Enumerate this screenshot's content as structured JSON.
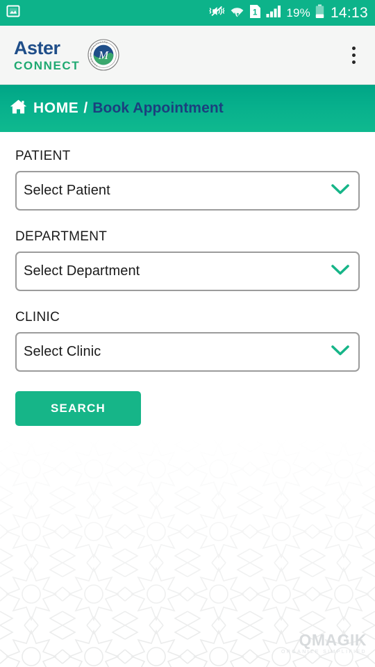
{
  "status_bar": {
    "left_icons": [
      {
        "name": "screenshot-image-icon"
      }
    ],
    "right_icons": [
      {
        "name": "vibrate-mute-icon"
      },
      {
        "name": "wifi-transfer-icon"
      },
      {
        "name": "sim-card-1-icon"
      },
      {
        "name": "signal-bars-icon"
      }
    ],
    "battery_percent": "19%",
    "battery_icon": "battery-low-icon",
    "time": "14:13",
    "background_color": "#0DB38A"
  },
  "header": {
    "brand_primary": "Aster",
    "brand_secondary": "CONNECT",
    "brand_primary_color": "#1F4E89",
    "brand_secondary_color": "#1FA971",
    "badge_icon": "aster-dm-healthcare-seal-icon",
    "overflow_icon": "overflow-menu-icon",
    "background_color": "#F5F6F5"
  },
  "breadcrumb": {
    "home_icon": "home-icon",
    "home_label": "HOME",
    "separator": "/",
    "current_label": "Book Appointment",
    "current_color": "#1B3F7E",
    "background_color": "#0DB38A"
  },
  "form": {
    "fields": [
      {
        "label": "PATIENT",
        "value": "Select Patient",
        "placeholder": "Select Patient",
        "chevron_icon": "chevron-down-icon"
      },
      {
        "label": "DEPARTMENT",
        "value": "Select Department",
        "placeholder": "Select Department",
        "chevron_icon": "chevron-down-icon"
      },
      {
        "label": "CLINIC",
        "value": "Select Clinic",
        "placeholder": "Select Clinic",
        "chevron_icon": "chevron-down-icon"
      }
    ],
    "search_label": "SEARCH",
    "search_color": "#16B588",
    "chevron_color": "#16B588",
    "field_border_color": "#9b9b9b"
  },
  "watermark": {
    "text": "QMAGIK",
    "tagline": "ORGANIZE SIMPLIFIED",
    "pattern_icon": "islamic-star-pattern"
  }
}
